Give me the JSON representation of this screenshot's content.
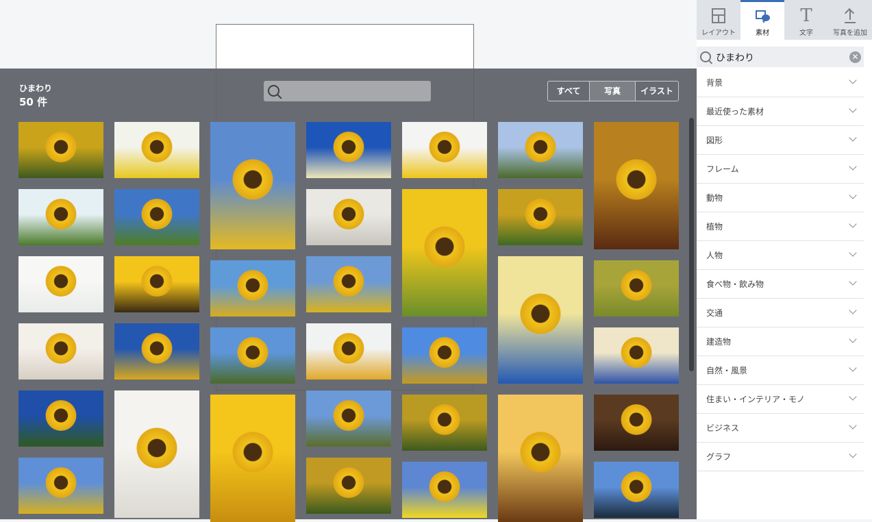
{
  "panel": {
    "query": "ひまわり",
    "count": "50 件",
    "search_placeholder": "",
    "filters": [
      {
        "label": "すべて",
        "active": false
      },
      {
        "label": "写真",
        "active": true
      },
      {
        "label": "イラスト",
        "active": false
      }
    ]
  },
  "tabs": [
    {
      "label": "レイアウト",
      "icon": "layout-icon",
      "active": false
    },
    {
      "label": "素材",
      "icon": "material-icon",
      "active": true
    },
    {
      "label": "文字",
      "icon": "text-icon",
      "active": false
    },
    {
      "label": "写真を追加",
      "icon": "upload-icon",
      "active": false
    }
  ],
  "sidebar": {
    "search_value": "ひまわり",
    "categories": [
      "背景",
      "最近使った素材",
      "図形",
      "フレーム",
      "動物",
      "植物",
      "人物",
      "食べ物・飲み物",
      "交通",
      "建造物",
      "自然・風景",
      "住まい・インテリア・モノ",
      "ビジネス",
      "グラフ"
    ]
  },
  "photos": [
    {
      "subject": "sunflower field",
      "colors": [
        "#c9a41a",
        "#3d5a1e"
      ]
    },
    {
      "subject": "sunflower closeup",
      "colors": [
        "#e5f0f5",
        "#4c7a2a"
      ]
    },
    {
      "subject": "sunflower in vase",
      "colors": [
        "#f7f7f5",
        "#e9ecea"
      ]
    },
    {
      "subject": "sunflower window",
      "colors": [
        "#f3efe9",
        "#d8cfc4"
      ]
    },
    {
      "subject": "sunflower field blue sky",
      "colors": [
        "#1f4fa8",
        "#2f5a22"
      ]
    },
    {
      "subject": "sunflowers sky",
      "colors": [
        "#5f8fd6",
        "#d6b01f"
      ]
    },
    {
      "subject": "single sunflower",
      "colors": [
        "#f2f3ea",
        "#e8c81e"
      ]
    },
    {
      "subject": "field hills",
      "colors": [
        "#3f77c6",
        "#4f7d24"
      ]
    },
    {
      "subject": "sunflower macro",
      "colors": [
        "#f3c41a",
        "#3a2a14"
      ]
    },
    {
      "subject": "sunflowers blue",
      "colors": [
        "#2457b0",
        "#d8a81c"
      ]
    },
    {
      "subject": "hand vase",
      "colors": [
        "#f4f3ef",
        "#dcd9d2"
      ]
    },
    {
      "subject": "sunflower bouquet clouds",
      "colors": [
        "#5c8bd0",
        "#e4ba22"
      ]
    },
    {
      "subject": "sunflowers sky",
      "colors": [
        "#5f9bd9",
        "#d8ad20"
      ]
    },
    {
      "subject": "sunflower field",
      "colors": [
        "#5d95d8",
        "#4b6a2a"
      ]
    },
    {
      "subject": "sunflower yellow",
      "colors": [
        "#f4c51a",
        "#c78e10"
      ]
    },
    {
      "subject": "wall window flowers",
      "colors": [
        "#1e55b8",
        "#efe6b8"
      ]
    },
    {
      "subject": "wall niche",
      "colors": [
        "#e9e8e3",
        "#c8c5bd"
      ]
    },
    {
      "subject": "sunflower blue",
      "colors": [
        "#6b9ad6",
        "#d9b31e"
      ]
    },
    {
      "subject": "sunflower glass",
      "colors": [
        "#f1f2f2",
        "#e0a92a"
      ]
    },
    {
      "subject": "field sky",
      "colors": [
        "#6c9ad8",
        "#5b6d2a"
      ]
    },
    {
      "subject": "sunflowers many",
      "colors": [
        "#c09a22",
        "#3b5a1e"
      ]
    },
    {
      "subject": "single white bg",
      "colors": [
        "#f4f4f2",
        "#efc41a"
      ]
    },
    {
      "subject": "sunflower bloom",
      "colors": [
        "#f0c61c",
        "#6a8f2a"
      ]
    },
    {
      "subject": "sunflowers field",
      "colors": [
        "#4f8be0",
        "#c59a20"
      ]
    },
    {
      "subject": "sunflowers dense",
      "colors": [
        "#b99a22",
        "#3d5a1e"
      ]
    },
    {
      "subject": "yellow flowers bouquet",
      "colors": [
        "#5d86d3",
        "#f1d820"
      ]
    },
    {
      "subject": "tall sunflower",
      "colors": [
        "#a9c2e6",
        "#4b6a2a"
      ]
    },
    {
      "subject": "sunflowers cluster",
      "colors": [
        "#c8a020",
        "#3d6a24"
      ]
    },
    {
      "subject": "yellow wall window",
      "colors": [
        "#efe49a",
        "#2359b5"
      ]
    },
    {
      "subject": "hanging basket",
      "colors": [
        "#f2c65c",
        "#6a3a14"
      ]
    },
    {
      "subject": "sunflowers red",
      "colors": [
        "#b8801e",
        "#5a2a12"
      ]
    },
    {
      "subject": "field green",
      "colors": [
        "#a7a43a",
        "#7a8a2a"
      ]
    },
    {
      "subject": "vase sunflowers wall",
      "colors": [
        "#efe6c9",
        "#2f53a8"
      ]
    },
    {
      "subject": "table flowers",
      "colors": [
        "#5a3a20",
        "#2c1a10"
      ]
    },
    {
      "subject": "sunflower silhouette",
      "colors": [
        "#5d8fd8",
        "#1a2a3a"
      ]
    }
  ]
}
